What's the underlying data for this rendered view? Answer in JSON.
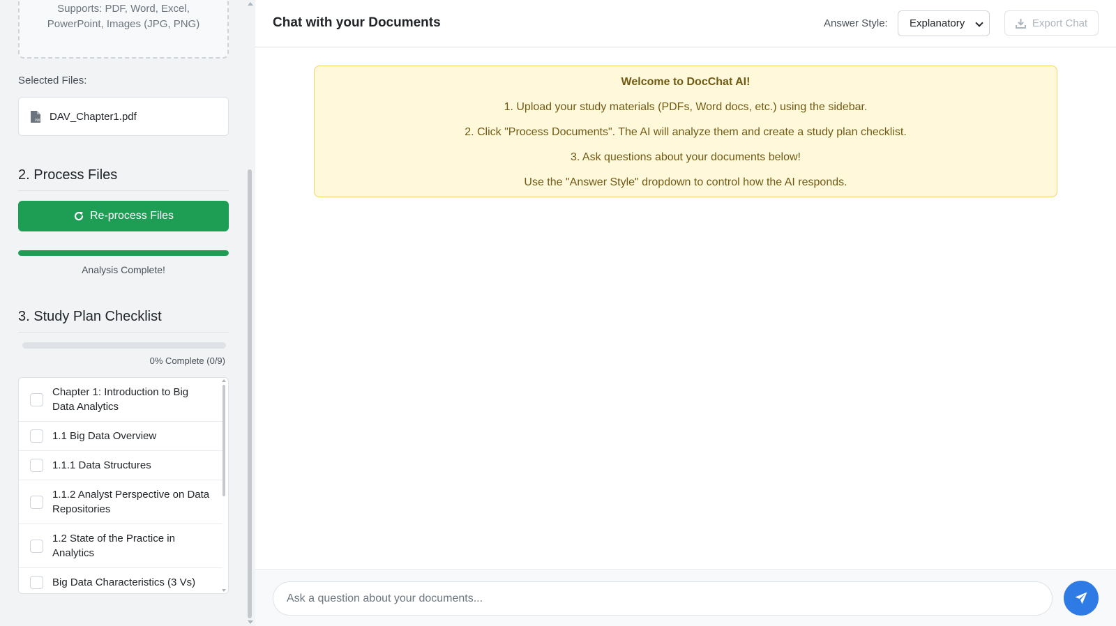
{
  "sidebar": {
    "upload_hint": "Supports: PDF, Word, Excel, PowerPoint, Images (JPG, PNG)",
    "selected_files_label": "Selected Files:",
    "files": [
      {
        "name": "DAV_Chapter1.pdf",
        "icon": "pdf-file-icon"
      }
    ],
    "process_title": "2. Process Files",
    "reprocess_label": "Re-process Files",
    "progress_fraction": 1.0,
    "progress_status": "Analysis Complete!",
    "study_title": "3. Study Plan Checklist",
    "study_progress_fraction": 0.0,
    "study_progress_text": "0% Complete (0/9)",
    "checklist": [
      {
        "label": "Chapter 1: Introduction to Big Data Analytics",
        "checked": false
      },
      {
        "label": "1.1 Big Data Overview",
        "checked": false
      },
      {
        "label": "1.1.1 Data Structures",
        "checked": false
      },
      {
        "label": "1.1.2 Analyst Perspective on Data Repositories",
        "checked": false
      },
      {
        "label": "1.2 State of the Practice in Analytics",
        "checked": false
      },
      {
        "label": "Big Data Characteristics (3 Vs)",
        "checked": false
      }
    ]
  },
  "header": {
    "title": "Chat with your Documents",
    "answer_style_label": "Answer Style:",
    "answer_style_value": "Explanatory",
    "export_label": "Export Chat"
  },
  "welcome": {
    "title": "Welcome to DocChat AI!",
    "lines": [
      "1. Upload your study materials (PDFs, Word docs, etc.) using the sidebar.",
      "2. Click \"Process Documents\". The AI will analyze them and create a study plan checklist.",
      "3. Ask questions about your documents below!",
      "Use the \"Answer Style\" dropdown to control how the AI responds."
    ]
  },
  "chat": {
    "placeholder": "Ask a question about your documents..."
  },
  "colors": {
    "success": "#1e9e55",
    "primary": "#2f7be5",
    "welcome_bg": "#fff8db",
    "welcome_border": "#f3d36b"
  }
}
